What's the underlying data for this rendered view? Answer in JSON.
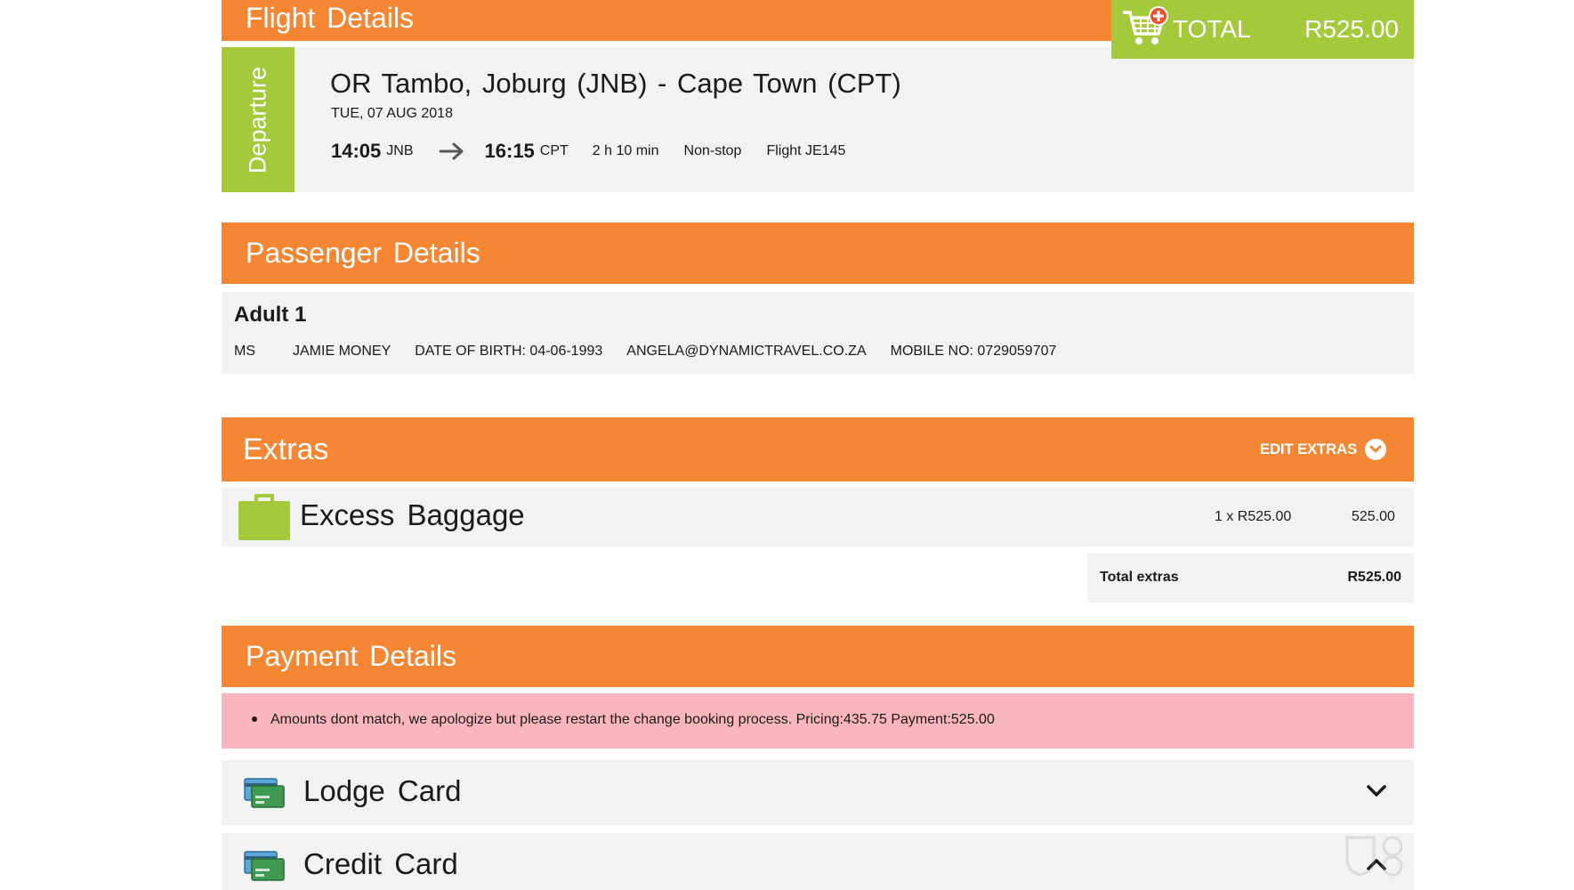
{
  "colors": {
    "accent_orange": "#f48634",
    "accent_green": "#a4c93b",
    "panel_grey": "#f2f2f2",
    "error_pink": "#fab5bd"
  },
  "flight": {
    "section_title": "Flight Details",
    "tab_label": "Departure",
    "route": "OR Tambo, Joburg (JNB) - Cape Town (CPT)",
    "date": "TUE, 07 AUG 2018",
    "depart_time": "14:05",
    "depart_code": "JNB",
    "arrive_time": "16:15",
    "arrive_code": "CPT",
    "duration": "2 h 10 min",
    "stops": "Non-stop",
    "flight_no": "Flight JE145"
  },
  "cart": {
    "label": "TOTAL",
    "amount": "R525.00",
    "icon": "shopping-cart-add-icon"
  },
  "passenger": {
    "section_title": "Passenger Details",
    "heading": "Adult 1",
    "title": "MS",
    "name": "JAMIE MONEY",
    "dob": "DATE OF BIRTH: 04-06-1993",
    "email": "ANGELA@DYNAMICTRAVEL.CO.ZA",
    "mobile": "MOBILE NO: 0729059707"
  },
  "extras": {
    "section_title": "Extras",
    "edit_label": "EDIT EXTRAS",
    "items": [
      {
        "name": "Excess Baggage",
        "qty": "1 x R525.00",
        "amount": "525.00",
        "icon": "suitcase-icon"
      }
    ],
    "total_label": "Total extras",
    "total_value": "R525.00"
  },
  "payment": {
    "section_title": "Payment Details",
    "error": "Amounts dont match, we apologize but please restart the change booking process. Pricing:435.75 Payment:525.00",
    "methods": [
      {
        "name": "Lodge Card",
        "state": "collapsed",
        "icon": "credit-cards-icon"
      },
      {
        "name": "Credit Card",
        "state": "expanded",
        "icon": "credit-cards-icon"
      }
    ]
  }
}
